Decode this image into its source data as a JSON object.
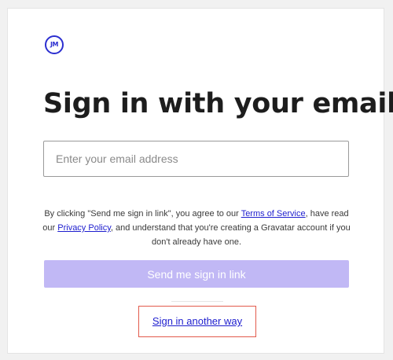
{
  "logo": {
    "text": "JM",
    "color": "#2b2ed0"
  },
  "heading": "Sign in with your email",
  "email": {
    "placeholder": "Enter your email address",
    "value": ""
  },
  "terms": {
    "part1": "By clicking \"Send me sign in link\", you agree to our ",
    "tos_link": "Terms of Service",
    "part2": ", have read our ",
    "privacy_link": "Privacy Policy",
    "part3": ", and understand that you're creating a Gravatar account if you don't already have one."
  },
  "send_button": {
    "label": "Send me sign in link",
    "color": "#c1b8f5"
  },
  "other_way_link": "Sign in another way",
  "colors": {
    "link": "#1d1dce",
    "highlight_border": "#e25a4c"
  }
}
